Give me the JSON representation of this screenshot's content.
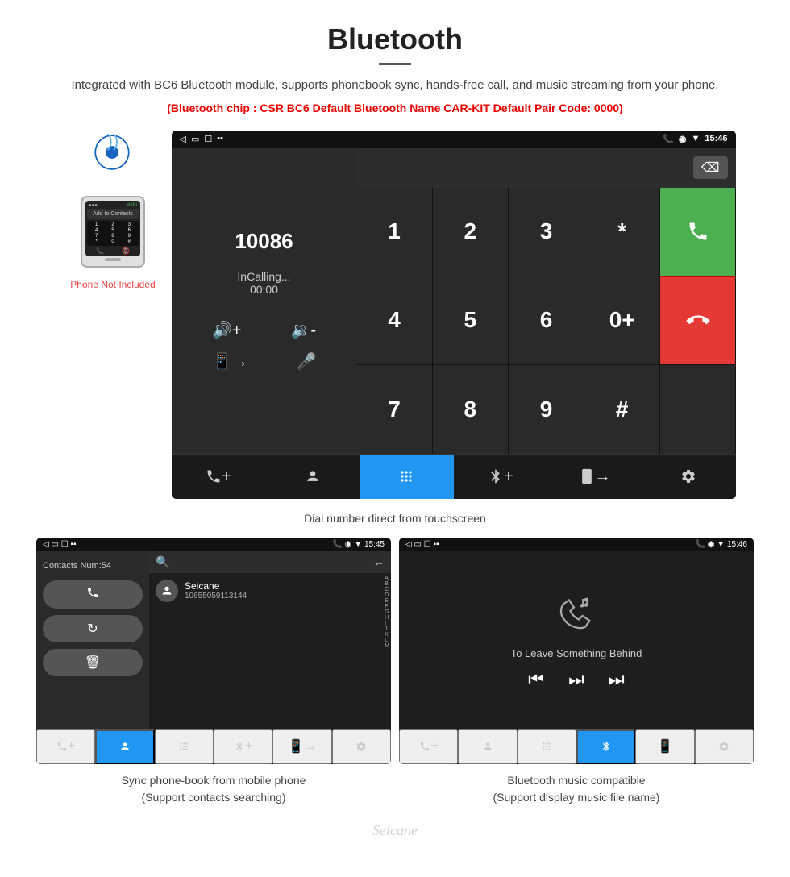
{
  "header": {
    "title": "Bluetooth",
    "description": "Integrated with BC6 Bluetooth module, supports phonebook sync, hands-free call, and music streaming from your phone.",
    "specs": "(Bluetooth chip : CSR BC6    Default Bluetooth Name CAR-KIT    Default Pair Code: 0000)"
  },
  "main_screen": {
    "status_bar": {
      "left_icons": "◁  ▭  ☐  ▪▪",
      "right_icons": "📞  ◉  ▼  15:46"
    },
    "dial_number": "10086",
    "calling_status": "InCalling...",
    "timer": "00:00",
    "keys": [
      "1",
      "2",
      "3",
      "*",
      "4",
      "5",
      "6",
      "0+",
      "7",
      "8",
      "9",
      "#"
    ],
    "call_label": "☎",
    "end_label": "📵"
  },
  "caption_main": "Dial number direct from touchscreen",
  "phonebook_screen": {
    "contacts_num": "Contacts Num:54",
    "contact_name": "Seicane",
    "contact_number": "10655059113144",
    "alpha_list": [
      "A",
      "B",
      "C",
      "D",
      "E",
      "F",
      "G",
      "H",
      "I",
      "J",
      "K",
      "L",
      "M"
    ]
  },
  "music_screen": {
    "song_title": "To Leave Something Behind"
  },
  "bottom_caption_left": "Sync phone-book from mobile phone\n(Support contacts searching)",
  "bottom_caption_right": "Bluetooth music compatible\n(Support display music file name)",
  "watermark": "Seicane",
  "phone_not_included": "Phone Not Included",
  "toolbar_items": [
    "☎+",
    "👤",
    "⠿",
    "✱+",
    "📱→",
    "⚙"
  ],
  "toolbar_items_small_pb": [
    "☎+",
    "👤",
    "⠿",
    "✱+",
    "📱→",
    "⚙"
  ],
  "toolbar_items_small_music": [
    "☎+",
    "👤",
    "⠿",
    "✱+",
    "📱→",
    "⚙"
  ]
}
